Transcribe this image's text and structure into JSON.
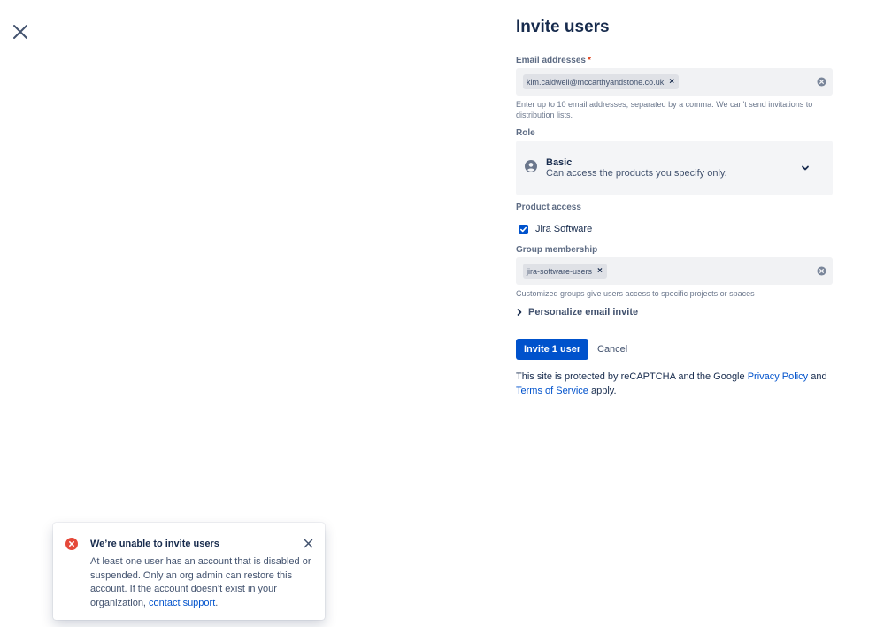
{
  "page": {
    "title": "Invite users"
  },
  "email": {
    "label": "Email addresses",
    "required_mark": "*",
    "tags": [
      "kim.caldwell@mccarthyandstone.co.uk"
    ],
    "helper": "Enter up to 10 email addresses, separated by a comma. We can't send invitations to distribution lists."
  },
  "role": {
    "label": "Role",
    "selected_name": "Basic",
    "selected_description": "Can access the products you specify only."
  },
  "product_access": {
    "label": "Product access",
    "products": [
      {
        "name": "Jira Software",
        "checked": true
      }
    ]
  },
  "group": {
    "label": "Group membership",
    "tags": [
      "jira-software-users"
    ],
    "helper": "Customized groups give users access to specific projects or spaces"
  },
  "personalize": {
    "label": "Personalize email invite"
  },
  "actions": {
    "invite_label": "Invite 1 user",
    "cancel_label": "Cancel"
  },
  "legal": {
    "text_before": "This site is protected by reCAPTCHA and the Google ",
    "privacy_link": "Privacy Policy",
    "text_middle": " and ",
    "terms_link": "Terms of Service",
    "text_after": " apply."
  },
  "flag": {
    "title": "We’re unable to invite users",
    "body": "At least one user has an account that is disabled or suspended. Only an org admin can restore this account. If the account doesn’t exist in your organization, ",
    "link": "contact support",
    "body_end": "."
  },
  "colors": {
    "primary": "#0052cc",
    "error": "#de350b",
    "text": "#172b4d",
    "subtle_text": "#6b778c",
    "field_bg": "#f1f2f4"
  }
}
